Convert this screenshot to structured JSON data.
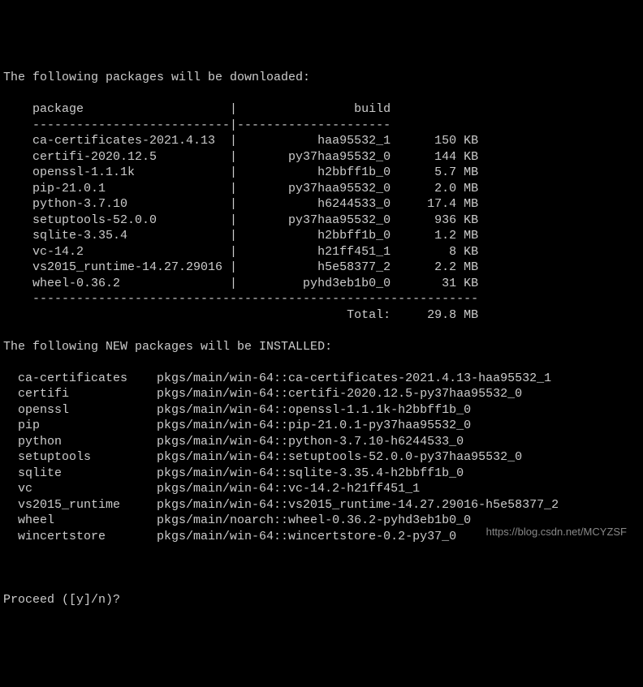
{
  "header_download": "The following packages will be downloaded:",
  "table_header_left": "package",
  "table_header_right": "build",
  "downloads": [
    {
      "pkg": "ca-certificates-2021.4.13",
      "build": "haa95532_1",
      "size": "150 KB"
    },
    {
      "pkg": "certifi-2020.12.5",
      "build": "py37haa95532_0",
      "size": "144 KB"
    },
    {
      "pkg": "openssl-1.1.1k",
      "build": "h2bbff1b_0",
      "size": "5.7 MB"
    },
    {
      "pkg": "pip-21.0.1",
      "build": "py37haa95532_0",
      "size": "2.0 MB"
    },
    {
      "pkg": "python-3.7.10",
      "build": "h6244533_0",
      "size": "17.4 MB"
    },
    {
      "pkg": "setuptools-52.0.0",
      "build": "py37haa95532_0",
      "size": "936 KB"
    },
    {
      "pkg": "sqlite-3.35.4",
      "build": "h2bbff1b_0",
      "size": "1.2 MB"
    },
    {
      "pkg": "vc-14.2",
      "build": "h21ff451_1",
      "size": "8 KB"
    },
    {
      "pkg": "vs2015_runtime-14.27.29016",
      "build": "h5e58377_2",
      "size": "2.2 MB"
    },
    {
      "pkg": "wheel-0.36.2",
      "build": "pyhd3eb1b0_0",
      "size": "31 KB"
    }
  ],
  "total_label": "Total:",
  "total_value": "29.8 MB",
  "header_install": "The following NEW packages will be INSTALLED:",
  "installs": [
    {
      "name": "ca-certificates",
      "spec": "pkgs/main/win-64::ca-certificates-2021.4.13-haa95532_1"
    },
    {
      "name": "certifi",
      "spec": "pkgs/main/win-64::certifi-2020.12.5-py37haa95532_0"
    },
    {
      "name": "openssl",
      "spec": "pkgs/main/win-64::openssl-1.1.1k-h2bbff1b_0"
    },
    {
      "name": "pip",
      "spec": "pkgs/main/win-64::pip-21.0.1-py37haa95532_0"
    },
    {
      "name": "python",
      "spec": "pkgs/main/win-64::python-3.7.10-h6244533_0"
    },
    {
      "name": "setuptools",
      "spec": "pkgs/main/win-64::setuptools-52.0.0-py37haa95532_0"
    },
    {
      "name": "sqlite",
      "spec": "pkgs/main/win-64::sqlite-3.35.4-h2bbff1b_0"
    },
    {
      "name": "vc",
      "spec": "pkgs/main/win-64::vc-14.2-h21ff451_1"
    },
    {
      "name": "vs2015_runtime",
      "spec": "pkgs/main/win-64::vs2015_runtime-14.27.29016-h5e58377_2"
    },
    {
      "name": "wheel",
      "spec": "pkgs/main/noarch::wheel-0.36.2-pyhd3eb1b0_0"
    },
    {
      "name": "wincertstore",
      "spec": "pkgs/main/win-64::wincertstore-0.2-py37_0"
    }
  ],
  "prompt": "Proceed ([y]/n)?",
  "watermark": "https://blog.csdn.net/MCYZSF"
}
